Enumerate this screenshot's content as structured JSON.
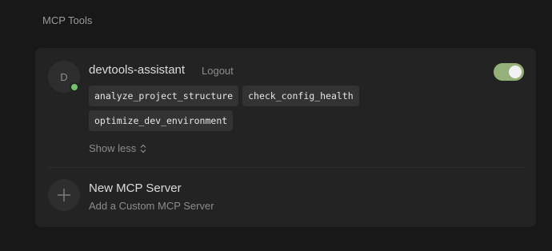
{
  "section": {
    "title": "MCP Tools"
  },
  "server": {
    "avatar_initial": "D",
    "name": "devtools-assistant",
    "logout_label": "Logout",
    "enabled": true,
    "status": "connected",
    "tools": [
      "analyze_project_structure",
      "check_config_health",
      "optimize_dev_environment"
    ],
    "show_less_label": "Show less"
  },
  "new_server": {
    "title": "New MCP Server",
    "subtitle": "Add a Custom MCP Server"
  },
  "colors": {
    "status_connected": "#72c26a",
    "toggle_on": "#96b07a",
    "panel_bg": "#232323",
    "page_bg": "#181818"
  },
  "icons": {
    "show_less": "chevron-up-down-icon",
    "add": "plus-icon"
  }
}
